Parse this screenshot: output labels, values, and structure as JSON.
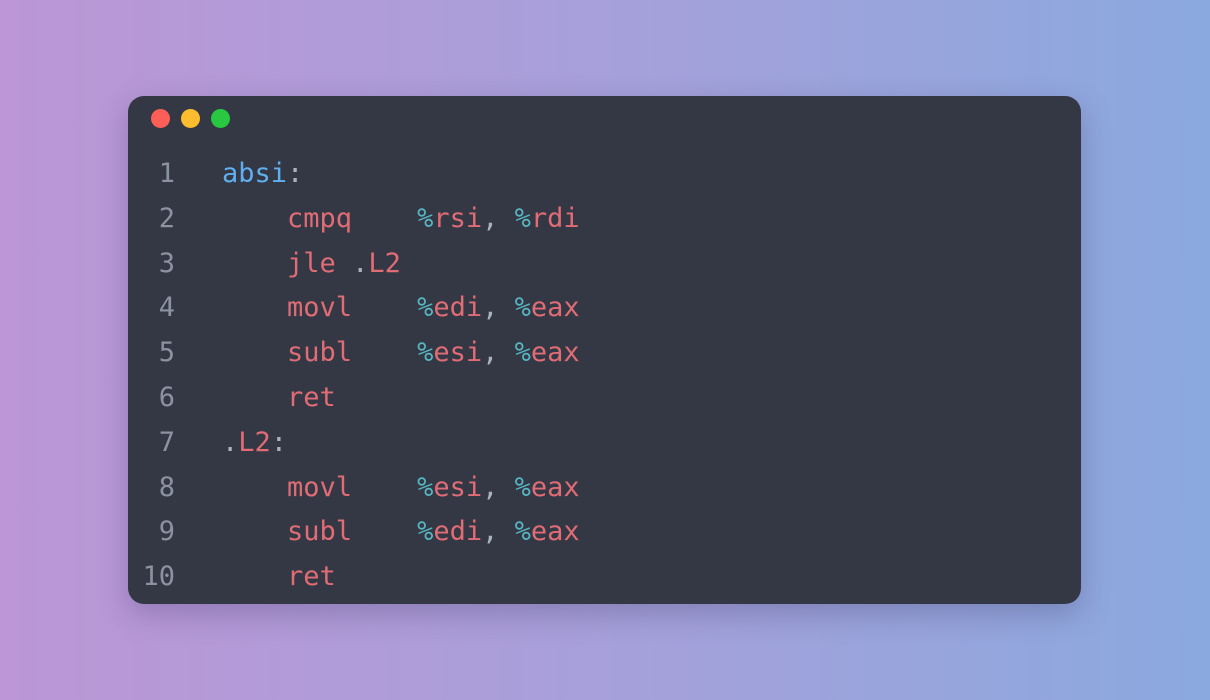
{
  "window": {
    "dots": [
      {
        "name": "close",
        "color": "#ff5f57"
      },
      {
        "name": "minimize",
        "color": "#febc2e"
      },
      {
        "name": "maximize",
        "color": "#28c840"
      }
    ]
  },
  "colors": {
    "label": "#61aff0",
    "mnemonic": "#e06c75",
    "register_prefix": "#56b6c2",
    "punctuation": "#abb2bf",
    "line_number": "#8b92a2"
  },
  "code": {
    "lines": [
      {
        "number": "1",
        "tokens": [
          {
            "t": "absi",
            "c": "label"
          },
          {
            "t": ":",
            "c": "punc"
          }
        ]
      },
      {
        "number": "2",
        "tokens": [
          {
            "t": "    ",
            "c": "punc"
          },
          {
            "t": "cmpq",
            "c": "op"
          },
          {
            "t": "    ",
            "c": "punc"
          },
          {
            "t": "%",
            "c": "pct"
          },
          {
            "t": "rsi",
            "c": "reg"
          },
          {
            "t": ", ",
            "c": "punc"
          },
          {
            "t": "%",
            "c": "pct"
          },
          {
            "t": "rdi",
            "c": "reg"
          }
        ]
      },
      {
        "number": "3",
        "tokens": [
          {
            "t": "    ",
            "c": "punc"
          },
          {
            "t": "jle",
            "c": "op"
          },
          {
            "t": " .",
            "c": "punc"
          },
          {
            "t": "L2",
            "c": "op"
          }
        ]
      },
      {
        "number": "4",
        "tokens": [
          {
            "t": "    ",
            "c": "punc"
          },
          {
            "t": "movl",
            "c": "op"
          },
          {
            "t": "    ",
            "c": "punc"
          },
          {
            "t": "%",
            "c": "pct"
          },
          {
            "t": "edi",
            "c": "reg"
          },
          {
            "t": ", ",
            "c": "punc"
          },
          {
            "t": "%",
            "c": "pct"
          },
          {
            "t": "eax",
            "c": "reg"
          }
        ]
      },
      {
        "number": "5",
        "tokens": [
          {
            "t": "    ",
            "c": "punc"
          },
          {
            "t": "subl",
            "c": "op"
          },
          {
            "t": "    ",
            "c": "punc"
          },
          {
            "t": "%",
            "c": "pct"
          },
          {
            "t": "esi",
            "c": "reg"
          },
          {
            "t": ", ",
            "c": "punc"
          },
          {
            "t": "%",
            "c": "pct"
          },
          {
            "t": "eax",
            "c": "reg"
          }
        ]
      },
      {
        "number": "6",
        "tokens": [
          {
            "t": "    ",
            "c": "punc"
          },
          {
            "t": "ret",
            "c": "op"
          }
        ]
      },
      {
        "number": "7",
        "tokens": [
          {
            "t": ".",
            "c": "punc"
          },
          {
            "t": "L2",
            "c": "op"
          },
          {
            "t": ":",
            "c": "punc"
          }
        ]
      },
      {
        "number": "8",
        "tokens": [
          {
            "t": "    ",
            "c": "punc"
          },
          {
            "t": "movl",
            "c": "op"
          },
          {
            "t": "    ",
            "c": "punc"
          },
          {
            "t": "%",
            "c": "pct"
          },
          {
            "t": "esi",
            "c": "reg"
          },
          {
            "t": ", ",
            "c": "punc"
          },
          {
            "t": "%",
            "c": "pct"
          },
          {
            "t": "eax",
            "c": "reg"
          }
        ]
      },
      {
        "number": "9",
        "tokens": [
          {
            "t": "    ",
            "c": "punc"
          },
          {
            "t": "subl",
            "c": "op"
          },
          {
            "t": "    ",
            "c": "punc"
          },
          {
            "t": "%",
            "c": "pct"
          },
          {
            "t": "edi",
            "c": "reg"
          },
          {
            "t": ", ",
            "c": "punc"
          },
          {
            "t": "%",
            "c": "pct"
          },
          {
            "t": "eax",
            "c": "reg"
          }
        ]
      },
      {
        "number": "10",
        "tokens": [
          {
            "t": "    ",
            "c": "punc"
          },
          {
            "t": "ret",
            "c": "op"
          }
        ]
      }
    ]
  }
}
